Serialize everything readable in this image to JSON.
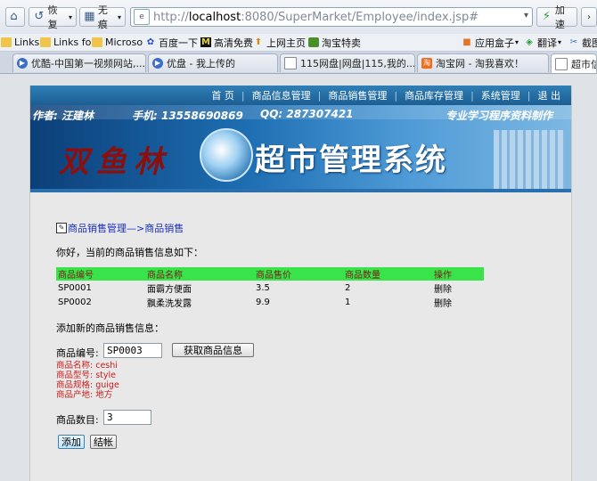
{
  "browser": {
    "home_icon": "home-icon",
    "back_label": "恢复",
    "fav_label": "无痕",
    "url_scheme_prefix": "http://",
    "url_host": "localhost",
    "url_rest": ":8080/SuperMarket/Employee/index.jsp#",
    "accelerate_label": "加速",
    "bookmarks": [
      {
        "label": "Links"
      },
      {
        "label": "Links fo"
      },
      {
        "label": "Microso"
      },
      {
        "label": "百度一下"
      },
      {
        "label": "高清免费"
      },
      {
        "label": "上网主页"
      },
      {
        "label": "淘宝特卖"
      },
      {
        "label": "应用盒子"
      },
      {
        "label": "翻译"
      },
      {
        "label": "截图"
      }
    ],
    "tabs": [
      {
        "label": "优酷-中国第一视频网站,..."
      },
      {
        "label": "优盘 - 我上传的"
      },
      {
        "label": "115网盘|网盘|115,我的..."
      },
      {
        "label": "淘宝网 - 淘我喜欢！"
      },
      {
        "label": "超市信息"
      }
    ]
  },
  "site": {
    "nav": [
      "首 页",
      "商品信息管理",
      "商品销售管理",
      "商品库存管理",
      "系统管理",
      "退 出"
    ],
    "banner_author": "作者: 汪建林",
    "banner_phone": "手机: 13558690869",
    "banner_qq": "QQ: 287307421",
    "banner_slogan": "专业学习程序资料制作",
    "logo_name": "双鱼林",
    "logo_title": "超市管理系统"
  },
  "content": {
    "breadcrumb": "商品销售管理—>商品销售",
    "greeting": "你好，当前的商品销售信息如下：",
    "table": {
      "headers": [
        "商品编号",
        "商品名称",
        "商品售价",
        "商品数量",
        "操作"
      ],
      "rows": [
        [
          "SP0001",
          "面霸方便面",
          "3.5",
          "2",
          "删除"
        ],
        [
          "SP0002",
          "飘柔洗发露",
          "9.9",
          "1",
          "删除"
        ]
      ]
    },
    "add_title": "添加新的商品销售信息：",
    "product_id_label": "商品编号:",
    "product_id_value": "SP0003",
    "fetch_button": "获取商品信息",
    "info": {
      "name": "商品名称: ceshi",
      "model": "商品型号: style",
      "spec": "商品规格: guige",
      "origin": "商品产地: 地方"
    },
    "quantity_label": "商品数目:",
    "quantity_value": "3",
    "add_button": "添加",
    "checkout_button": "结帐"
  }
}
